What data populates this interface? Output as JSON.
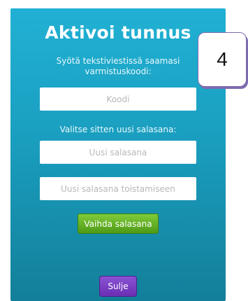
{
  "dialog": {
    "title": "Aktivoi tunnus",
    "instruction_line1": "Syötä tekstiviestissä saamasi",
    "instruction_line2": "varmistuskoodi:",
    "code_placeholder": "Koodi",
    "subheading": "Valitse sitten uusi salasana:",
    "new_password_placeholder": "Uusi salasana",
    "repeat_password_placeholder": "Uusi salasana toistamiseen",
    "change_button_label": "Vaihda salasana",
    "close_button_label": "Sulje"
  },
  "step_badge": {
    "number": "4"
  },
  "colors": {
    "panel_top": "#21b1d4",
    "panel_bottom": "#137f99",
    "change_button": "#5fa91f",
    "close_button": "#7a40c4",
    "badge_border": "#7d6bb0"
  }
}
